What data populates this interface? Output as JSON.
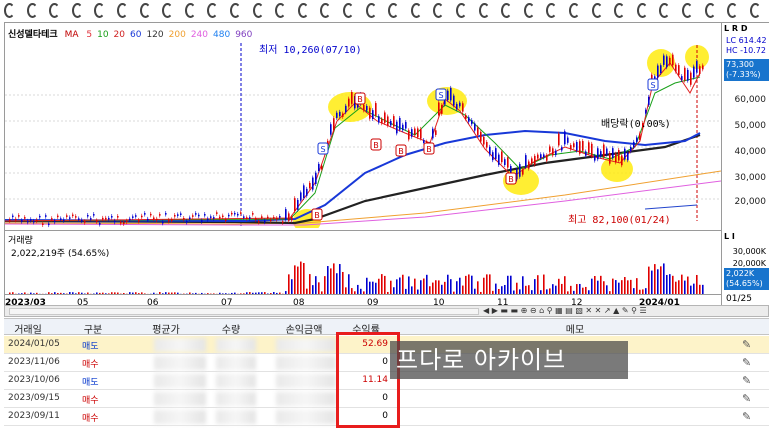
{
  "stock": {
    "name": "신성델타테크",
    "ma_label": "MA",
    "periods": [
      {
        "label": "5",
        "color": "#e0303a"
      },
      {
        "label": "10",
        "color": "#18a018"
      },
      {
        "label": "20",
        "color": "#d02020"
      },
      {
        "label": "60",
        "color": "#1838d8"
      },
      {
        "label": "120",
        "color": "#333333"
      },
      {
        "label": "200",
        "color": "#f0a030"
      },
      {
        "label": "240",
        "color": "#e060e0"
      },
      {
        "label": "480",
        "color": "#2080f0"
      },
      {
        "label": "960",
        "color": "#8040c0"
      }
    ]
  },
  "annotations": {
    "low": "최저 10,260(07/10)",
    "high": "최고 82,100(01/24)",
    "dividend": "배당락(0.00%)"
  },
  "price_axis": {
    "ticks": [
      "60,000",
      "50,000",
      "40,000",
      "30,000",
      "20,000"
    ],
    "lrd": "L R D",
    "lc": "LC 614.42",
    "hc": "HC -10.72",
    "current": "73,300",
    "change": "(-7.33%)"
  },
  "volume": {
    "label": "거래량",
    "value": "2,022,219주 (54.65%)",
    "ticks": [
      "30,000K",
      "20,000K"
    ],
    "lrd": "L I",
    "current": "2,022K",
    "pct": "(54.65%)"
  },
  "x_axis": {
    "labels": [
      "2023/03",
      "05",
      "06",
      "07",
      "08",
      "09",
      "10",
      "11",
      "12",
      "2024/01"
    ],
    "last": "01/25"
  },
  "toolbar_icons": "◀ ▶ ▬ ▬ ⊕ ⊖ ⌂ ⚲ ▦ ▤ ▧ ✕ ✕ ↗ ▲ ✎ ⚲ ☰",
  "table": {
    "headers": [
      "거래일",
      "구분",
      "평균가",
      "수량",
      "손익금액",
      "수익률",
      "메모"
    ],
    "rows": [
      {
        "date": "2024/01/05",
        "type": "매도",
        "kind": "sell",
        "ret": "52.69",
        "selected": true
      },
      {
        "date": "2023/11/06",
        "type": "매수",
        "kind": "buy",
        "ret": "0",
        "selected": false
      },
      {
        "date": "2023/10/06",
        "type": "매도",
        "kind": "sell",
        "ret": "11.14",
        "selected": false
      },
      {
        "date": "2023/09/15",
        "type": "매수",
        "kind": "buy",
        "ret": "0",
        "selected": false
      },
      {
        "date": "2023/09/11",
        "type": "매수",
        "kind": "buy",
        "ret": "0",
        "selected": false
      }
    ]
  },
  "watermark": "프다로 아카이브",
  "colors": {
    "candle_up": "#e00000",
    "candle_down": "#0000d0",
    "ma60": "#1838d8",
    "ma120": "#222222",
    "ma5": "#e02020",
    "ma10": "#18a018",
    "highlight": "#ffea00",
    "box_red": "#e81d1d"
  }
}
